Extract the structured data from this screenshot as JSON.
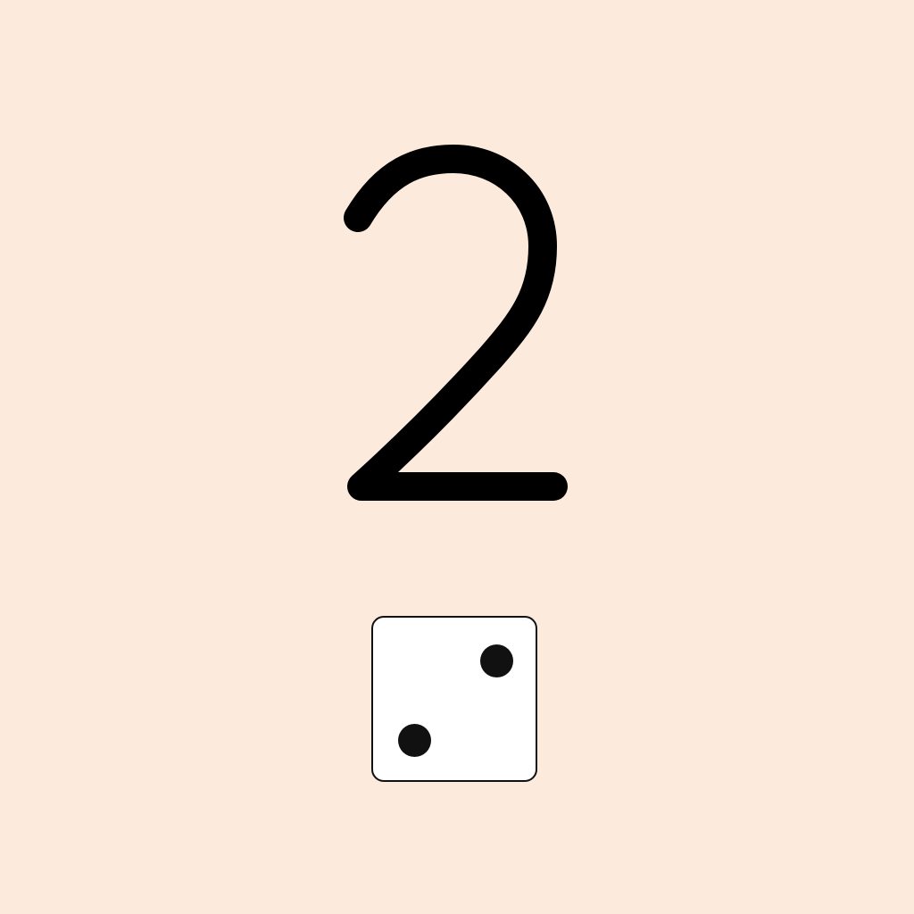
{
  "game": {
    "rolled_number": "2",
    "die": {
      "value": 2,
      "face_color": "#ffffff",
      "pip_color": "#111111",
      "pips": [
        "top-right",
        "bottom-left"
      ]
    },
    "background_color": "#fcebdc",
    "number_color": "#000000"
  }
}
